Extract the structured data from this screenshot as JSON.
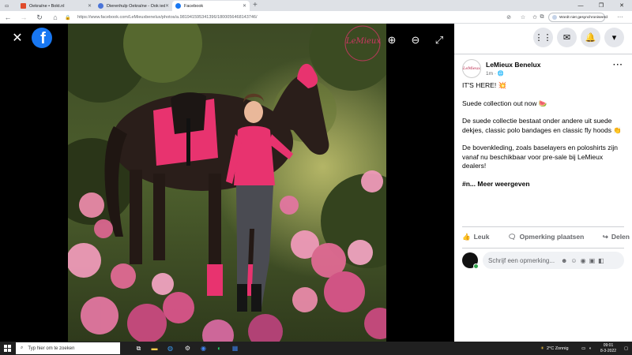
{
  "browser": {
    "tabs": [
      {
        "title": "Oekraïne • Bokt.nl",
        "favicon_color": "#e04b2b"
      },
      {
        "title": "Dierenhulp Oekraïne - Ook iedere",
        "favicon_color": "#4a74d8"
      },
      {
        "title": "Facebook",
        "favicon_color": "#1877f2"
      }
    ],
    "new_tab": "+",
    "url": "https://www.facebook.com/LeMieuxbenelux/photos/a.981941595341396/1800056468143746/",
    "sync_label": "Wordt niet gesynchroniseerd"
  },
  "photo": {
    "watermark": "LeMieux",
    "colors": {
      "accent": "#e8336f",
      "horse": "#2a1e1a"
    }
  },
  "overlay": {
    "close_icon": "close-icon",
    "logo_letter": "f"
  },
  "post": {
    "page_name": "LeMieux Benelux",
    "time": "1m ·",
    "avatar_text": "LeMieux",
    "lines": [
      "IT'S HERE! 💥",
      "Suede collection out now 🍉",
      "De suede collectie bestaat onder andere uit suede dekjes, classic polo bandages en classic fly hoods 👏",
      "De bovenkleding, zoals baselayers en poloshirts zijn vanaf nu beschikbaar voor pre-sale bij LeMieux dealers!"
    ],
    "hashtag": "#n...",
    "see_more": "Meer weergeven"
  },
  "actions": {
    "like": "Leuk",
    "comment": "Opmerking plaatsen",
    "share": "Delen"
  },
  "comment": {
    "placeholder": "Schrijf een opmerking..."
  },
  "taskbar": {
    "search_placeholder": "Typ hier om te zoeken",
    "weather": "2°C  Zonnig",
    "time": "09:01",
    "date": "8-3-2022"
  }
}
